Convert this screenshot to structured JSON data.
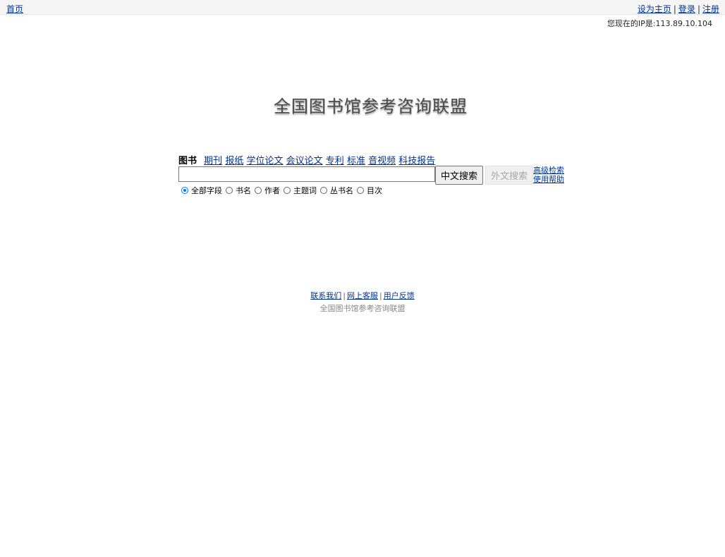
{
  "topbar": {
    "home": "首页",
    "set_homepage": "设为主页",
    "login": "登录",
    "register": "注册",
    "separator": "|"
  },
  "ip_notice": "您现在的IP是:113.89.10.104",
  "logo_text": "全国图书馆参考咨询联盟",
  "tabs": [
    {
      "label": "图书",
      "active": true
    },
    {
      "label": "期刊",
      "active": false
    },
    {
      "label": "报纸",
      "active": false
    },
    {
      "label": "学位论文",
      "active": false
    },
    {
      "label": "会议论文",
      "active": false
    },
    {
      "label": "专利",
      "active": false
    },
    {
      "label": "标准",
      "active": false
    },
    {
      "label": "音视频",
      "active": false
    },
    {
      "label": "科技报告",
      "active": false
    }
  ],
  "search": {
    "value": "",
    "chinese_search_label": "中文搜索",
    "foreign_search_label": "外文搜索",
    "advanced_search": "高级检索",
    "help": "使用帮助"
  },
  "fields": [
    {
      "label": "全部字段",
      "checked": true
    },
    {
      "label": "书名",
      "checked": false
    },
    {
      "label": "作者",
      "checked": false
    },
    {
      "label": "主题词",
      "checked": false
    },
    {
      "label": "丛书名",
      "checked": false
    },
    {
      "label": "目次",
      "checked": false
    }
  ],
  "footer": {
    "contact": "联系我们",
    "online_service": "网上客服",
    "feedback": "用户反馈",
    "separator": "|",
    "copyright": "全国图书馆参考咨询联盟"
  }
}
